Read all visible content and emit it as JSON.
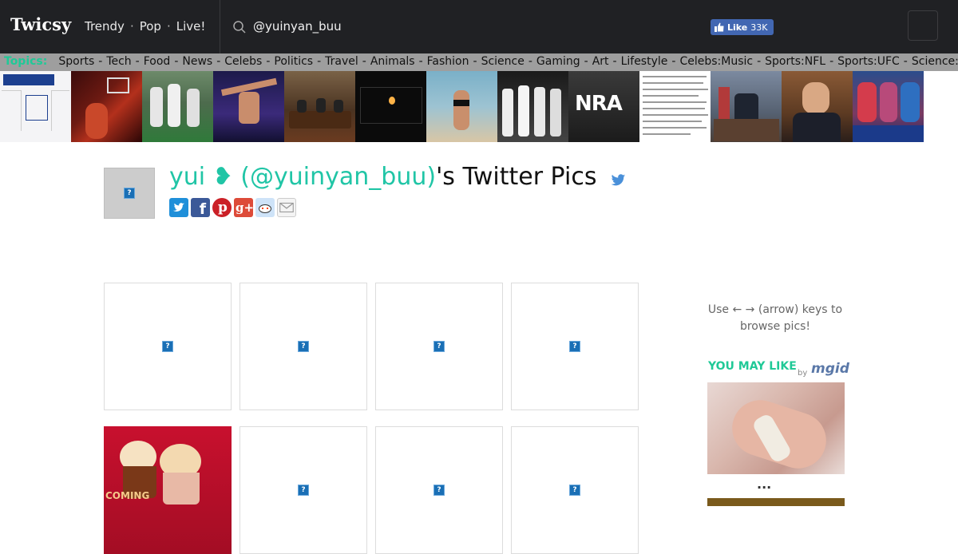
{
  "header": {
    "logo": "Twicsy",
    "nav": [
      "Trendy",
      "Pop",
      "Live!"
    ],
    "search_value": "@yuinyan_buu",
    "fb_like_label": "Like",
    "fb_like_count": "33K"
  },
  "topics": {
    "label": "Topics:",
    "items": [
      "Sports",
      "Tech",
      "Food",
      "News",
      "Celebs",
      "Politics",
      "Travel",
      "Animals",
      "Fashion",
      "Science",
      "Gaming",
      "Art",
      "Lifestyle",
      "Celebs:Music",
      "Sports:NFL",
      "Sports:UFC",
      "Science:Sp"
    ]
  },
  "profile": {
    "name": "yui ❥ (@yuinyan_buu)",
    "title_suffix": "'s Twitter Pics",
    "share_icons": [
      "twitter-icon",
      "facebook-icon",
      "pinterest-icon",
      "google-plus-icon",
      "reddit-icon",
      "email-icon"
    ]
  },
  "sidebar": {
    "hint": "Use ← → (arrow) keys to browse pics!",
    "you_may_like": "YOU MAY LIKE",
    "by": "by",
    "mgid": "mgid",
    "more": "..."
  },
  "grid": {
    "coming_label": "COMING"
  },
  "colors": {
    "accent": "#20c997",
    "name_color": "#20c5a6",
    "header_bg": "#202124",
    "topics_bg": "#9e9e9e"
  }
}
